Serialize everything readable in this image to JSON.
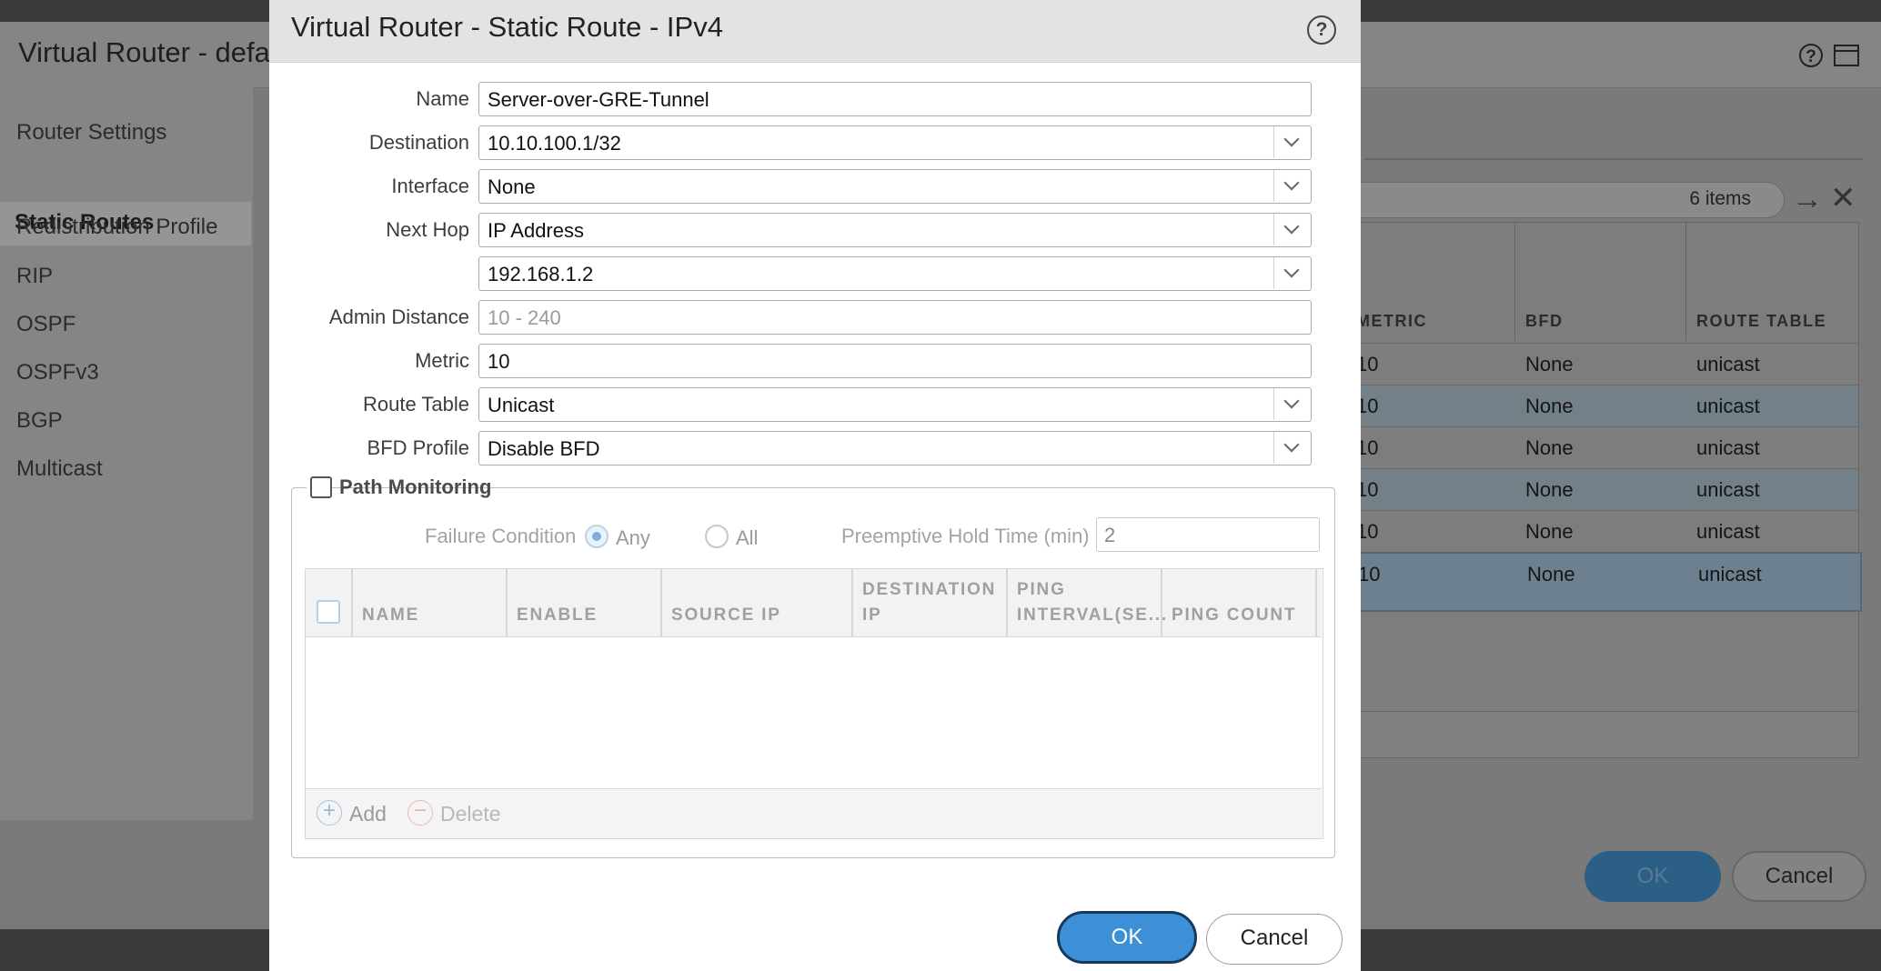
{
  "background": {
    "window_title": "Virtual Router - defa",
    "sidebar": {
      "items": [
        "Router Settings",
        "Static Routes",
        "Redistribution Profile",
        "RIP",
        "OSPF",
        "OSPFv3",
        "BGP",
        "Multicast"
      ],
      "active": "Static Routes"
    },
    "items_count": "6 items",
    "table": {
      "headers": [
        "METRIC",
        "BFD",
        "ROUTE TABLE"
      ],
      "rows": [
        [
          "10",
          "None",
          "unicast"
        ],
        [
          "10",
          "None",
          "unicast"
        ],
        [
          "10",
          "None",
          "unicast"
        ],
        [
          "10",
          "None",
          "unicast"
        ],
        [
          "10",
          "None",
          "unicast"
        ],
        [
          "10",
          "None",
          "unicast"
        ]
      ]
    },
    "ok_label": "OK",
    "cancel_label": "Cancel"
  },
  "dialog": {
    "title": "Virtual Router - Static Route - IPv4",
    "help_glyph": "?",
    "fields": {
      "name": {
        "label": "Name",
        "value": "Server-over-GRE-Tunnel"
      },
      "destination": {
        "label": "Destination",
        "value": "10.10.100.1/32"
      },
      "interface": {
        "label": "Interface",
        "value": "None"
      },
      "next_hop": {
        "label": "Next Hop",
        "value": "IP Address"
      },
      "next_hop_ip": {
        "value": "192.168.1.2"
      },
      "admin_distance": {
        "label": "Admin Distance",
        "value": "",
        "placeholder": "10 - 240"
      },
      "metric": {
        "label": "Metric",
        "value": "10"
      },
      "route_table": {
        "label": "Route Table",
        "value": "Unicast"
      },
      "bfd_profile": {
        "label": "BFD Profile",
        "value": "Disable BFD"
      }
    },
    "path_monitoring": {
      "label": "Path Monitoring",
      "checked": false,
      "failure_condition_label": "Failure Condition",
      "options": [
        "Any",
        "All"
      ],
      "selected": "Any",
      "preemptive_hold_label": "Preemptive Hold Time (min)",
      "preemptive_hold_value": "2",
      "table_headers": [
        "NAME",
        "ENABLE",
        "SOURCE IP",
        "DESTINATION",
        "IP",
        "PING",
        "INTERVAL(SE...",
        "PING COUNT"
      ],
      "add_label": "Add",
      "delete_label": "Delete"
    },
    "ok_label": "OK",
    "cancel_label": "Cancel"
  },
  "icons": {
    "help": "help-circle-icon",
    "window": "window-icon",
    "arrow": "arrow-right-icon",
    "close": "close-icon",
    "chevron": "chevron-down-icon",
    "add": "plus-circle-icon",
    "delete": "minus-circle-icon"
  },
  "colors": {
    "accent": "#3d8fd6",
    "ok_border": "#173a5c",
    "overlay": "#7a7a7a"
  }
}
